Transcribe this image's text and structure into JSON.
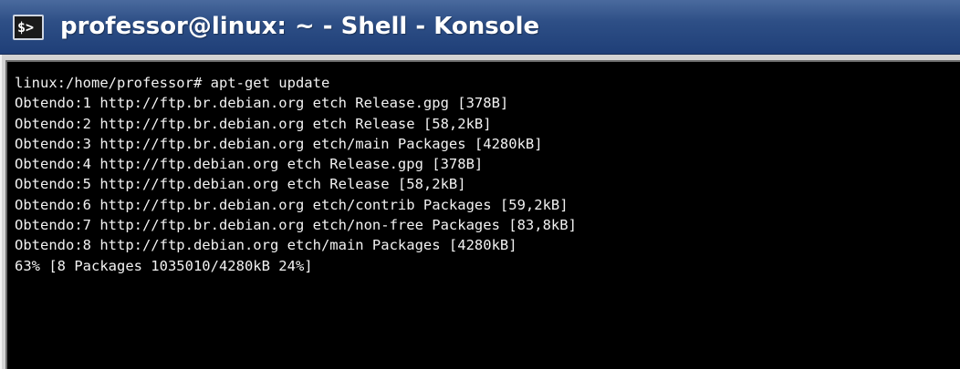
{
  "window": {
    "title": "professor@linux: ~ - Shell - Konsole",
    "icon": "konsole-terminal-icon",
    "icon_glyph": "$>"
  },
  "terminal": {
    "lines": [
      "linux:/home/professor# apt-get update",
      "Obtendo:1 http://ftp.br.debian.org etch Release.gpg [378B]",
      "Obtendo:2 http://ftp.br.debian.org etch Release [58,2kB]",
      "Obtendo:3 http://ftp.br.debian.org etch/main Packages [4280kB]",
      "Obtendo:4 http://ftp.debian.org etch Release.gpg [378B]",
      "Obtendo:5 http://ftp.debian.org etch Release [58,2kB]",
      "Obtendo:6 http://ftp.br.debian.org etch/contrib Packages [59,2kB]",
      "Obtendo:7 http://ftp.br.debian.org etch/non-free Packages [83,8kB]",
      "Obtendo:8 http://ftp.debian.org etch/main Packages [4280kB]",
      "63% [8 Packages 1035010/4280kB 24%]"
    ]
  },
  "colors": {
    "titlebar": "#2e4f86",
    "terminal_bg": "#000000",
    "terminal_fg": "#f2f2f2"
  }
}
